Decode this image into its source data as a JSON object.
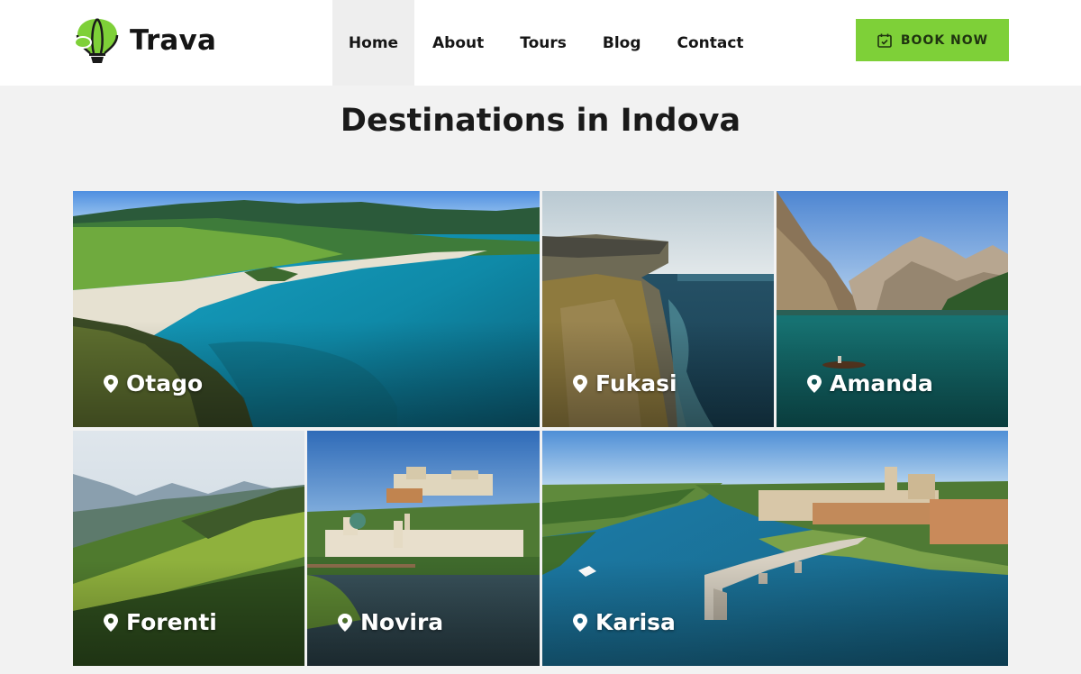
{
  "brand": {
    "name": "Trava",
    "accent": "#7ed038"
  },
  "nav": {
    "items": [
      {
        "label": "Home",
        "active": true
      },
      {
        "label": "About",
        "active": false
      },
      {
        "label": "Tours",
        "active": false
      },
      {
        "label": "Blog",
        "active": false
      },
      {
        "label": "Contact",
        "active": false
      }
    ]
  },
  "book_button": {
    "label": "BOOK NOW",
    "icon": "calendar-check-icon"
  },
  "page": {
    "title": "Destinations in Indova"
  },
  "destinations": [
    {
      "name": "Otago",
      "icon": "map-pin-icon"
    },
    {
      "name": "Fukasi",
      "icon": "map-pin-icon"
    },
    {
      "name": "Amanda",
      "icon": "map-pin-icon"
    },
    {
      "name": "Forenti",
      "icon": "map-pin-icon"
    },
    {
      "name": "Novira",
      "icon": "map-pin-icon"
    },
    {
      "name": "Karisa",
      "icon": "map-pin-icon"
    }
  ]
}
